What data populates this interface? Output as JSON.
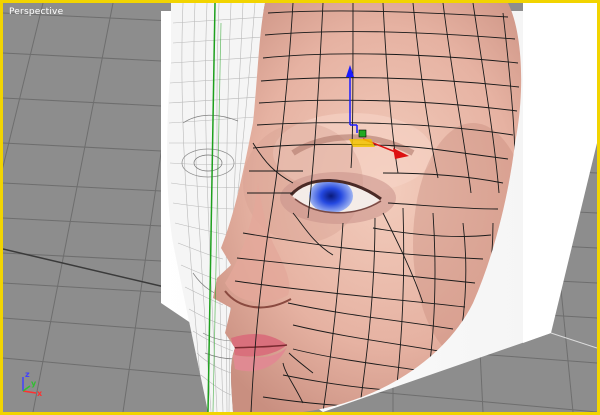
{
  "viewport": {
    "label": "Perspective",
    "active_border_color": "#f2d400",
    "background_color": "#8d8d8d"
  },
  "scene": {
    "subject": "3D head model with quad wireframe overlay and skin texture",
    "texture_plane_color": "#ffffff",
    "skin_color": "#e8b8a8",
    "wire_color": "#1a1a1a",
    "eye_color": "#1e3fd0",
    "lip_color": "#d9707c"
  },
  "gizmo": {
    "z_axis_color": "#1a1aff",
    "x_axis_color": "#dd1111",
    "y_axis_color": "#22aa22",
    "center_color": "#f2c400"
  },
  "axis_tripod": {
    "x_label": "x",
    "y_label": "y",
    "z_label": "z",
    "x_color": "#ff3030",
    "y_color": "#30c030",
    "z_color": "#4040ff"
  }
}
